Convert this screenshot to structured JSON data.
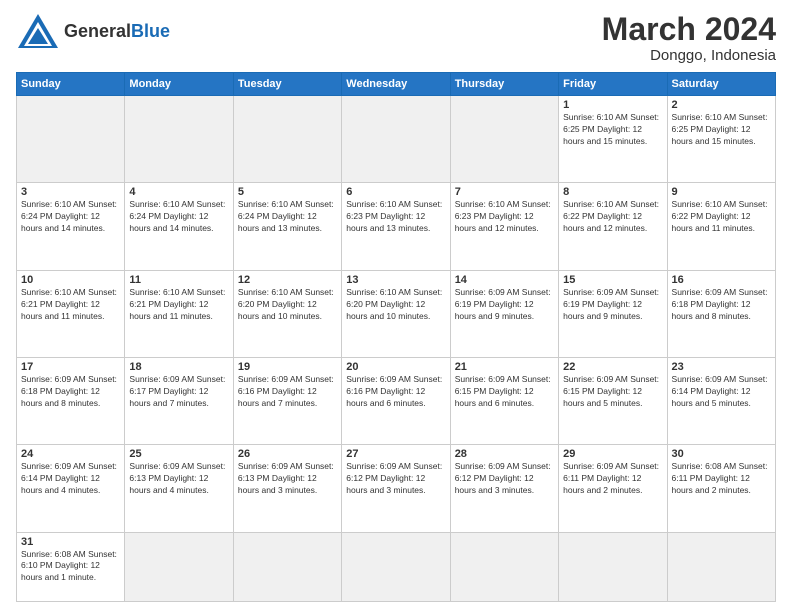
{
  "header": {
    "logo_general": "General",
    "logo_blue": "Blue",
    "month_title": "March 2024",
    "location": "Donggo, Indonesia"
  },
  "days_of_week": [
    "Sunday",
    "Monday",
    "Tuesday",
    "Wednesday",
    "Thursday",
    "Friday",
    "Saturday"
  ],
  "weeks": [
    [
      {
        "day": "",
        "info": "",
        "empty": true
      },
      {
        "day": "",
        "info": "",
        "empty": true
      },
      {
        "day": "",
        "info": "",
        "empty": true
      },
      {
        "day": "",
        "info": "",
        "empty": true
      },
      {
        "day": "",
        "info": "",
        "empty": true
      },
      {
        "day": "1",
        "info": "Sunrise: 6:10 AM\nSunset: 6:25 PM\nDaylight: 12 hours\nand 15 minutes."
      },
      {
        "day": "2",
        "info": "Sunrise: 6:10 AM\nSunset: 6:25 PM\nDaylight: 12 hours\nand 15 minutes."
      }
    ],
    [
      {
        "day": "3",
        "info": "Sunrise: 6:10 AM\nSunset: 6:24 PM\nDaylight: 12 hours\nand 14 minutes."
      },
      {
        "day": "4",
        "info": "Sunrise: 6:10 AM\nSunset: 6:24 PM\nDaylight: 12 hours\nand 14 minutes."
      },
      {
        "day": "5",
        "info": "Sunrise: 6:10 AM\nSunset: 6:24 PM\nDaylight: 12 hours\nand 13 minutes."
      },
      {
        "day": "6",
        "info": "Sunrise: 6:10 AM\nSunset: 6:23 PM\nDaylight: 12 hours\nand 13 minutes."
      },
      {
        "day": "7",
        "info": "Sunrise: 6:10 AM\nSunset: 6:23 PM\nDaylight: 12 hours\nand 12 minutes."
      },
      {
        "day": "8",
        "info": "Sunrise: 6:10 AM\nSunset: 6:22 PM\nDaylight: 12 hours\nand 12 minutes."
      },
      {
        "day": "9",
        "info": "Sunrise: 6:10 AM\nSunset: 6:22 PM\nDaylight: 12 hours\nand 11 minutes."
      }
    ],
    [
      {
        "day": "10",
        "info": "Sunrise: 6:10 AM\nSunset: 6:21 PM\nDaylight: 12 hours\nand 11 minutes."
      },
      {
        "day": "11",
        "info": "Sunrise: 6:10 AM\nSunset: 6:21 PM\nDaylight: 12 hours\nand 11 minutes."
      },
      {
        "day": "12",
        "info": "Sunrise: 6:10 AM\nSunset: 6:20 PM\nDaylight: 12 hours\nand 10 minutes."
      },
      {
        "day": "13",
        "info": "Sunrise: 6:10 AM\nSunset: 6:20 PM\nDaylight: 12 hours\nand 10 minutes."
      },
      {
        "day": "14",
        "info": "Sunrise: 6:09 AM\nSunset: 6:19 PM\nDaylight: 12 hours\nand 9 minutes."
      },
      {
        "day": "15",
        "info": "Sunrise: 6:09 AM\nSunset: 6:19 PM\nDaylight: 12 hours\nand 9 minutes."
      },
      {
        "day": "16",
        "info": "Sunrise: 6:09 AM\nSunset: 6:18 PM\nDaylight: 12 hours\nand 8 minutes."
      }
    ],
    [
      {
        "day": "17",
        "info": "Sunrise: 6:09 AM\nSunset: 6:18 PM\nDaylight: 12 hours\nand 8 minutes."
      },
      {
        "day": "18",
        "info": "Sunrise: 6:09 AM\nSunset: 6:17 PM\nDaylight: 12 hours\nand 7 minutes."
      },
      {
        "day": "19",
        "info": "Sunrise: 6:09 AM\nSunset: 6:16 PM\nDaylight: 12 hours\nand 7 minutes."
      },
      {
        "day": "20",
        "info": "Sunrise: 6:09 AM\nSunset: 6:16 PM\nDaylight: 12 hours\nand 6 minutes."
      },
      {
        "day": "21",
        "info": "Sunrise: 6:09 AM\nSunset: 6:15 PM\nDaylight: 12 hours\nand 6 minutes."
      },
      {
        "day": "22",
        "info": "Sunrise: 6:09 AM\nSunset: 6:15 PM\nDaylight: 12 hours\nand 5 minutes."
      },
      {
        "day": "23",
        "info": "Sunrise: 6:09 AM\nSunset: 6:14 PM\nDaylight: 12 hours\nand 5 minutes."
      }
    ],
    [
      {
        "day": "24",
        "info": "Sunrise: 6:09 AM\nSunset: 6:14 PM\nDaylight: 12 hours\nand 4 minutes."
      },
      {
        "day": "25",
        "info": "Sunrise: 6:09 AM\nSunset: 6:13 PM\nDaylight: 12 hours\nand 4 minutes."
      },
      {
        "day": "26",
        "info": "Sunrise: 6:09 AM\nSunset: 6:13 PM\nDaylight: 12 hours\nand 3 minutes."
      },
      {
        "day": "27",
        "info": "Sunrise: 6:09 AM\nSunset: 6:12 PM\nDaylight: 12 hours\nand 3 minutes."
      },
      {
        "day": "28",
        "info": "Sunrise: 6:09 AM\nSunset: 6:12 PM\nDaylight: 12 hours\nand 3 minutes."
      },
      {
        "day": "29",
        "info": "Sunrise: 6:09 AM\nSunset: 6:11 PM\nDaylight: 12 hours\nand 2 minutes."
      },
      {
        "day": "30",
        "info": "Sunrise: 6:08 AM\nSunset: 6:11 PM\nDaylight: 12 hours\nand 2 minutes."
      }
    ],
    [
      {
        "day": "31",
        "info": "Sunrise: 6:08 AM\nSunset: 6:10 PM\nDaylight: 12 hours\nand 1 minute.",
        "last": true
      },
      {
        "day": "",
        "info": "",
        "empty": true,
        "last": true
      },
      {
        "day": "",
        "info": "",
        "empty": true,
        "last": true
      },
      {
        "day": "",
        "info": "",
        "empty": true,
        "last": true
      },
      {
        "day": "",
        "info": "",
        "empty": true,
        "last": true
      },
      {
        "day": "",
        "info": "",
        "empty": true,
        "last": true
      },
      {
        "day": "",
        "info": "",
        "empty": true,
        "last": true
      }
    ]
  ]
}
